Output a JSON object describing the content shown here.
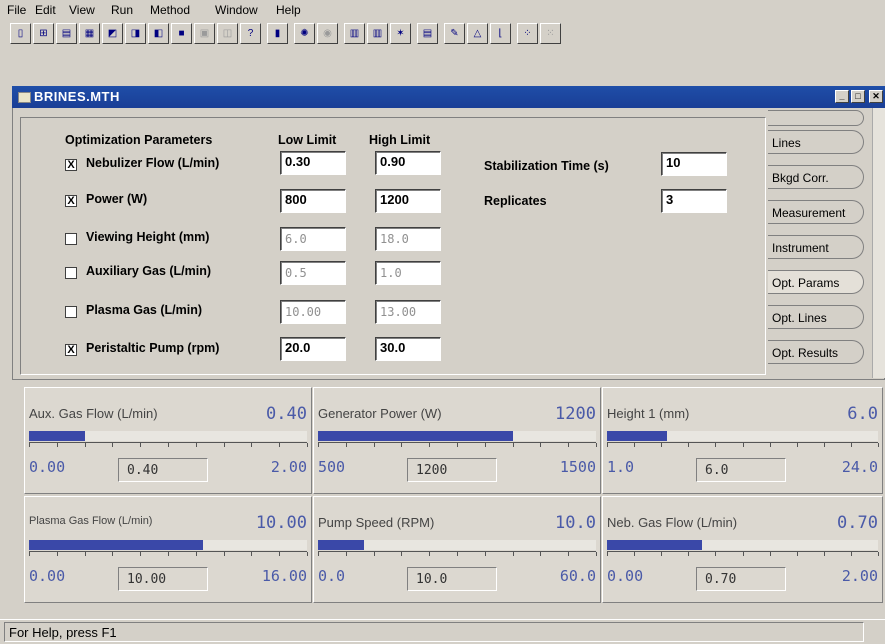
{
  "menu": [
    "File",
    "Edit",
    "View",
    "Run",
    "Method",
    "Window",
    "Help"
  ],
  "window": {
    "title": "BRINES.MTH"
  },
  "params": {
    "headers": {
      "opt": "Optimization Parameters",
      "low": "Low Limit",
      "high": "High Limit"
    },
    "rows": [
      {
        "label": "Nebulizer Flow (L/min)",
        "checked": "X",
        "low": "0.30",
        "high": "0.90"
      },
      {
        "label": "Power (W)",
        "checked": "X",
        "low": "800",
        "high": "1200"
      },
      {
        "label": "Viewing Height (mm)",
        "checked": "",
        "low": "6.0",
        "high": "18.0"
      },
      {
        "label": "Auxiliary Gas (L/min)",
        "checked": "",
        "low": "0.5",
        "high": "1.0"
      },
      {
        "label": "Plasma Gas (L/min)",
        "checked": "",
        "low": "10.00",
        "high": "13.00"
      },
      {
        "label": "Peristaltic Pump (rpm)",
        "checked": "X",
        "low": "20.0",
        "high": "30.0"
      }
    ],
    "stabilization": {
      "label": "Stabilization Time (s)",
      "value": "10"
    },
    "replicates": {
      "label": "Replicates",
      "value": "3"
    }
  },
  "tabs": [
    "Lines",
    "Bkgd Corr.",
    "Measurement",
    "Instrument",
    "Opt. Params",
    "Opt. Lines",
    "Opt. Results"
  ],
  "gauges": [
    {
      "label": "Aux. Gas Flow (L/min)",
      "value": "0.40",
      "min": "0.00",
      "max": "2.00",
      "current": "0.40",
      "fill": 0.2
    },
    {
      "label": "Generator Power (W)",
      "value": "1200",
      "min": "500",
      "max": "1500",
      "current": "1200",
      "fill": 0.7
    },
    {
      "label": "Height 1 (mm)",
      "value": "6.0",
      "min": "1.0",
      "max": "24.0",
      "current": "6.0",
      "fill": 0.22
    },
    {
      "label": "Plasma Gas Flow (L/min)",
      "value": "10.00",
      "min": "0.00",
      "max": "16.00",
      "current": "10.00",
      "fill": 0.625
    },
    {
      "label": "Pump Speed (RPM)",
      "value": "10.0",
      "min": "0.0",
      "max": "60.0",
      "current": "10.0",
      "fill": 0.167
    },
    {
      "label": "Neb. Gas Flow (L/min)",
      "value": "0.70",
      "min": "0.00",
      "max": "2.00",
      "current": "0.70",
      "fill": 0.35
    }
  ],
  "status": "For Help, press F1"
}
